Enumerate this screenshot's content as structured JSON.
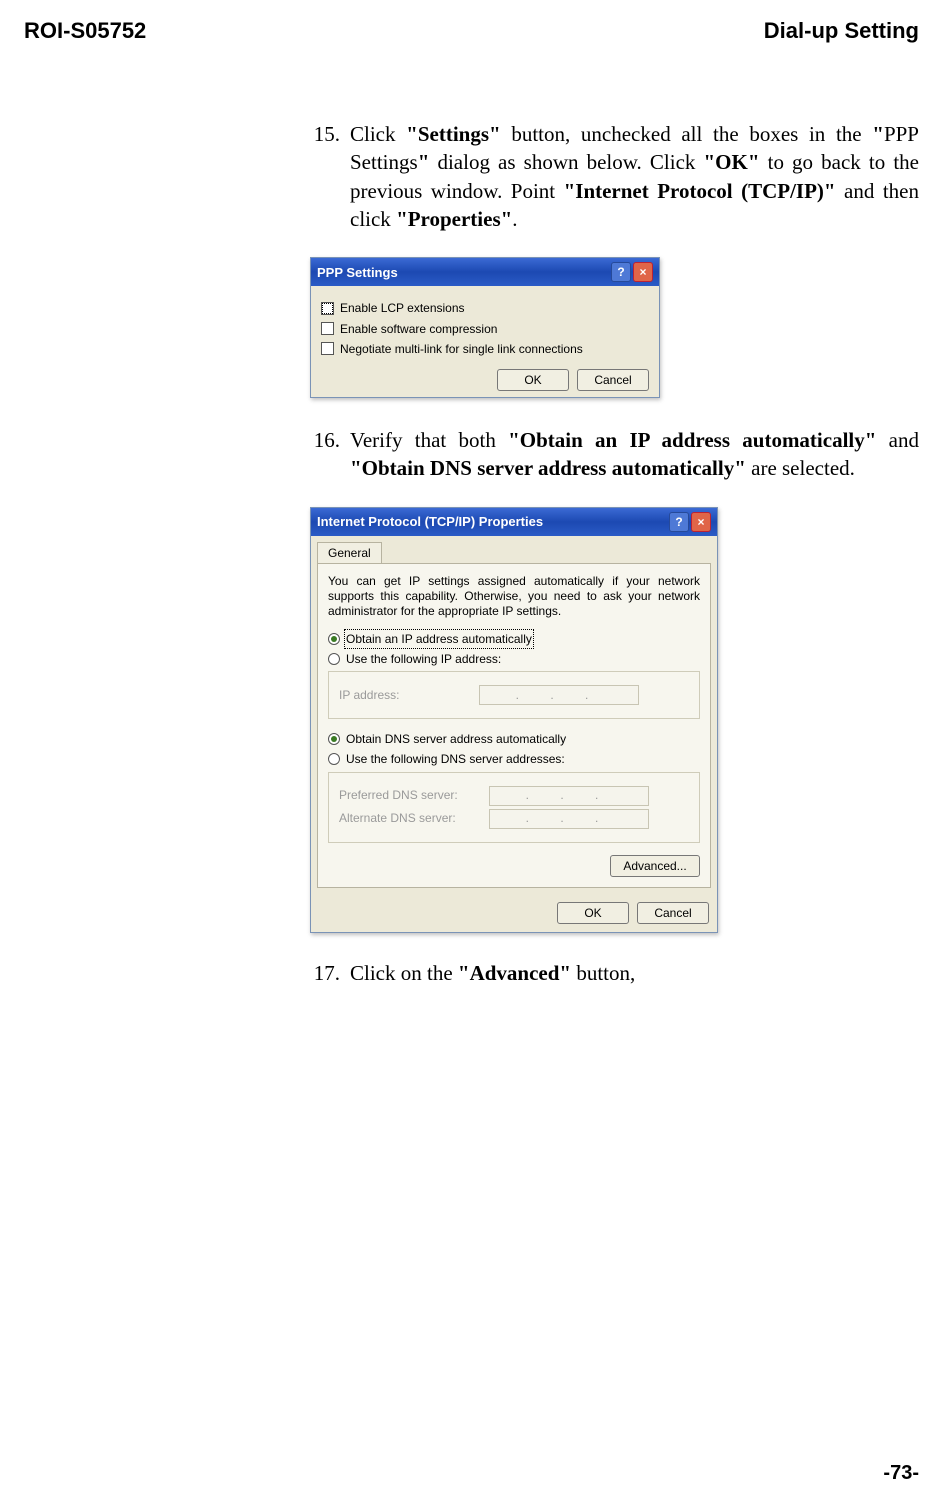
{
  "header": {
    "left": "ROI-S05752",
    "right": "Dial-up Setting"
  },
  "steps": {
    "s15": {
      "num": "15.",
      "pre": "Click ",
      "b1": "\"Settings\"",
      "mid1": " button, unchecked all the boxes in the ",
      "b2": "\"",
      "plain1": "PPP Settings",
      "b3": "\"",
      "mid2": " dialog as shown below. Click ",
      "b4": "\"OK\"",
      "mid3": " to go back to the previous window. Point ",
      "b5": "\"Internet Protocol (TCP/IP)\"",
      "mid4": " and then click ",
      "b6": "\"Properties\"",
      "tail": "."
    },
    "s16": {
      "num": "16.",
      "pre": "Verify that both ",
      "b1": "\"Obtain an IP address automatically\"",
      "mid": " and ",
      "b2": "\"Obtain DNS server address automatically\"",
      "tail": " are selected."
    },
    "s17": {
      "num": "17.",
      "pre": "Click on the ",
      "b1": "\"Advanced\"",
      "tail": " button,"
    }
  },
  "ppp": {
    "title": "PPP Settings",
    "cb1": "Enable LCP extensions",
    "cb2": "Enable software compression",
    "cb3": "Negotiate multi-link for single link connections",
    "ok": "OK",
    "cancel": "Cancel",
    "help": "?",
    "close": "×"
  },
  "tcp": {
    "title": "Internet Protocol (TCP/IP) Properties",
    "tab": "General",
    "desc": "You can get IP settings assigned automatically if your network supports this capability. Otherwise, you need to ask your network administrator for the appropriate IP settings.",
    "r1": "Obtain an IP address automatically",
    "r2": "Use the following IP address:",
    "ip_label": "IP address:",
    "r3": "Obtain DNS server address automatically",
    "r4": "Use the following DNS server addresses:",
    "pref": "Preferred DNS server:",
    "alt": "Alternate DNS server:",
    "dots": ". . .",
    "adv": "Advanced...",
    "ok": "OK",
    "cancel": "Cancel",
    "help": "?",
    "close": "×"
  },
  "footer": "-73-"
}
